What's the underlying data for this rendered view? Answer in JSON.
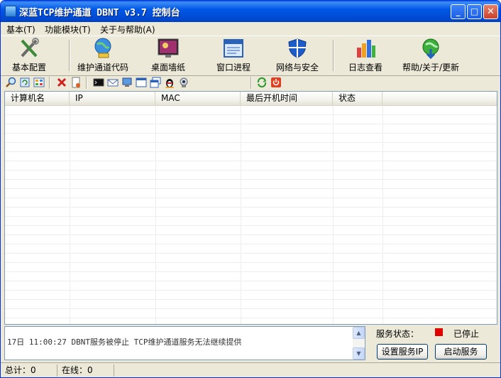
{
  "window": {
    "title": "深蓝TCP维护通道 DBNT v3.7 控制台"
  },
  "title_buttons": {
    "minimize": "_",
    "maximize": "□",
    "close": "✕"
  },
  "menu": [
    "基本(T)",
    "功能模块(T)",
    "关于与帮助(A)"
  ],
  "toolbar": [
    {
      "label": "基本配置",
      "icon": "tools-icon"
    },
    {
      "label": "维护通道代码",
      "icon": "globe-computer-icon"
    },
    {
      "label": "桌面墙纸",
      "icon": "wallpaper-icon"
    },
    {
      "label": "窗口进程",
      "icon": "window-process-icon"
    },
    {
      "label": "网络与安全",
      "icon": "shield-icon"
    },
    {
      "label": "日志查看",
      "icon": "bar-chart-icon"
    },
    {
      "label": "帮助/关于/更新",
      "icon": "globe-update-icon"
    }
  ],
  "table": {
    "columns": [
      "计算机名",
      "IP",
      "MAC",
      "最后开机时间",
      "状态"
    ],
    "rows": []
  },
  "log": {
    "lines": [
      "17日 11:00:27 DBNT服务被停止 TCP维护通道服务无法继续提供"
    ]
  },
  "service": {
    "label": "服务状态：",
    "state": "已停止",
    "state_color": "#e00000",
    "set_ip_button": "设置服务IP",
    "start_button": "启动服务"
  },
  "status": {
    "total": "总计：0",
    "online": "在线：0"
  },
  "colors": {
    "titlebar": "#0058e6",
    "window_bg": "#ece9d8",
    "grid_line": "#ededed"
  }
}
